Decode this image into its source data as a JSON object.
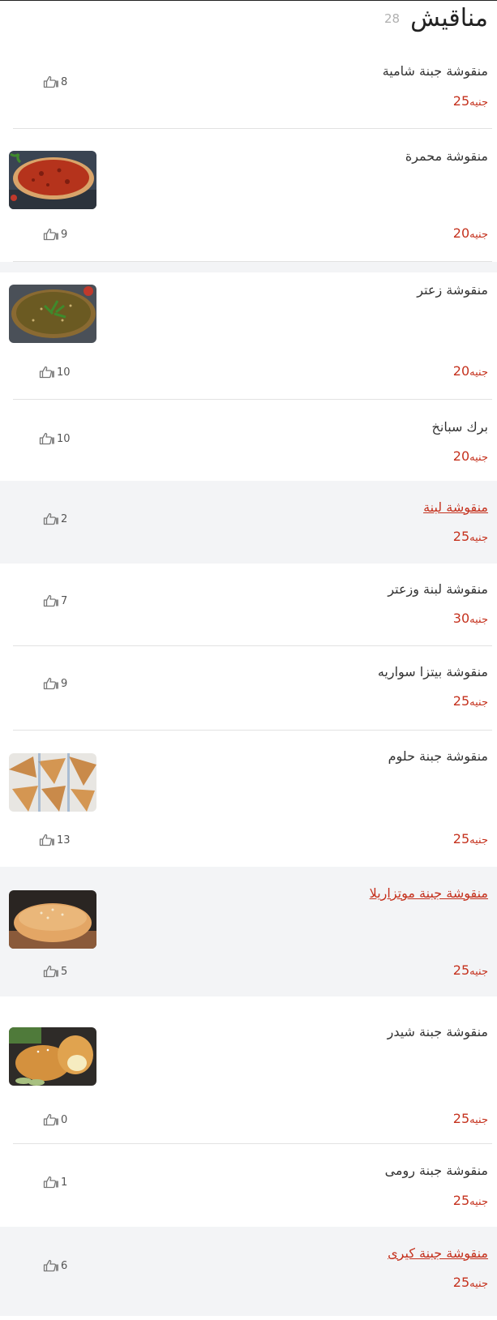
{
  "header": {
    "title": "مناقيش",
    "count": "28"
  },
  "currency": "جنيه",
  "colors": {
    "accent": "#c5321e",
    "row_gray": "#f3f4f6"
  },
  "items": [
    {
      "name": "منقوشة جبنة شامية",
      "price": "25",
      "likes": "8",
      "image": ""
    },
    {
      "name": "منقوشة محمرة",
      "price": "20",
      "likes": "9",
      "image": "muhammara-manakish"
    },
    {
      "name": "منقوشة زعتر",
      "price": "20",
      "likes": "10",
      "image": "zaatar-manakish"
    },
    {
      "name": "برك سبانخ",
      "price": "20",
      "likes": "10",
      "image": ""
    },
    {
      "name": "منقوشة لبنة",
      "price": "25",
      "likes": "2",
      "image": ""
    },
    {
      "name": "منقوشة لبنة وزعتر",
      "price": "30",
      "likes": "7",
      "image": ""
    },
    {
      "name": "منقوشة بيتزا سواريه",
      "price": "25",
      "likes": "9",
      "image": ""
    },
    {
      "name": "منقوشة جبنة حلوم",
      "price": "25",
      "likes": "13",
      "image": "halloumi-pastries"
    },
    {
      "name": "منقوشة جبنة موتزاريلا",
      "price": "25",
      "likes": "5",
      "image": "mozzarella-bun"
    },
    {
      "name": "منقوشة جبنة شيدر",
      "price": "25",
      "likes": "0",
      "image": "cheddar-bun"
    },
    {
      "name": "منقوشة جبنة رومى",
      "price": "25",
      "likes": "1",
      "image": ""
    },
    {
      "name": "منقوشة جبنة كيرى",
      "price": "25",
      "likes": "6",
      "image": ""
    }
  ]
}
